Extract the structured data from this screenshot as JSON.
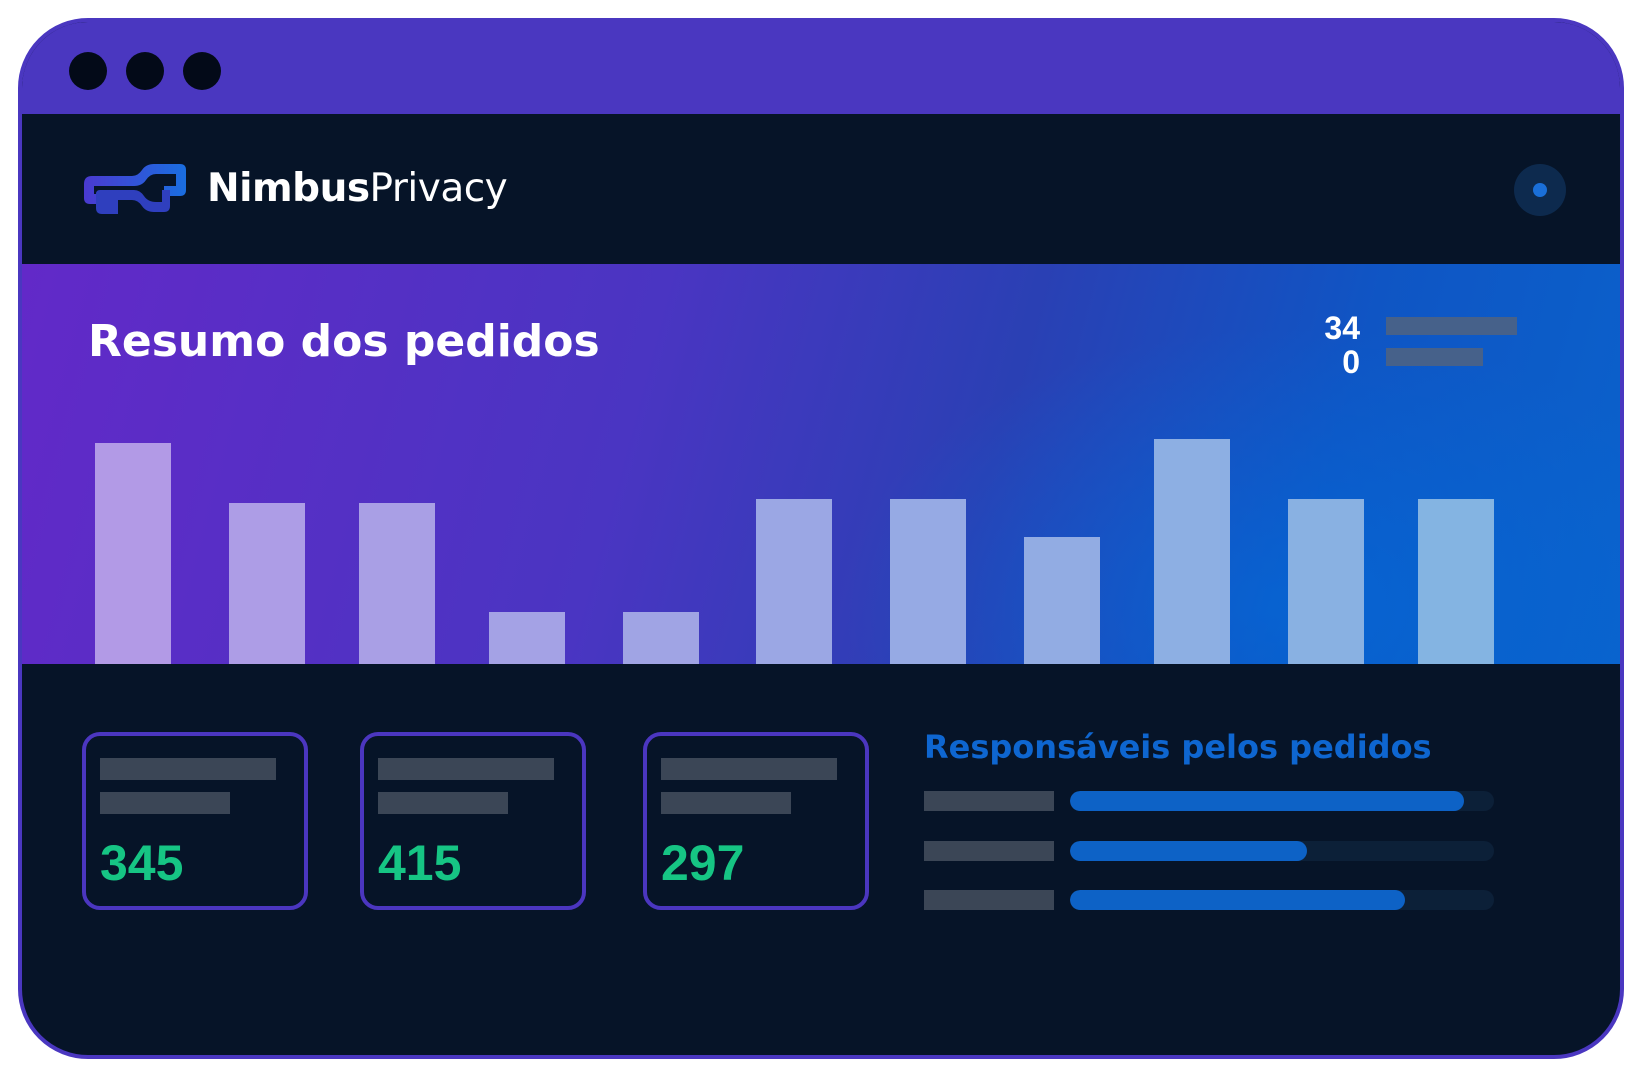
{
  "window": {
    "controls": [
      "window-dot",
      "window-dot",
      "window-dot"
    ]
  },
  "header": {
    "brand_bold": "Nimbus",
    "brand_regular": "Privacy",
    "logo_icon": "nimbus-logo-icon",
    "user_icon": "user-avatar-icon"
  },
  "hero": {
    "title": "Resumo dos pedidos",
    "legend_top": "34",
    "legend_bottom": "0"
  },
  "chart_data": {
    "type": "bar",
    "title": "Resumo dos pedidos",
    "values": [
      221,
      161,
      161,
      52,
      52,
      165,
      165,
      127,
      225,
      165,
      165
    ],
    "ylim": [
      0,
      240
    ],
    "bar_color_start": "#b29ae6",
    "bar_color_end": "#84b4e2"
  },
  "stats": [
    {
      "value": "345"
    },
    {
      "value": "415"
    },
    {
      "value": "297"
    }
  ],
  "responsibles": {
    "title": "Responsáveis pelos pedidos",
    "bars": [
      {
        "fraction": 0.93
      },
      {
        "fraction": 0.56
      },
      {
        "fraction": 0.79
      }
    ],
    "accent_color": "#0d62c6"
  },
  "colors": {
    "frame": "#4a37c0",
    "background": "#061428",
    "stat_value": "#16c584",
    "responsibles_title": "#0e66d0"
  }
}
